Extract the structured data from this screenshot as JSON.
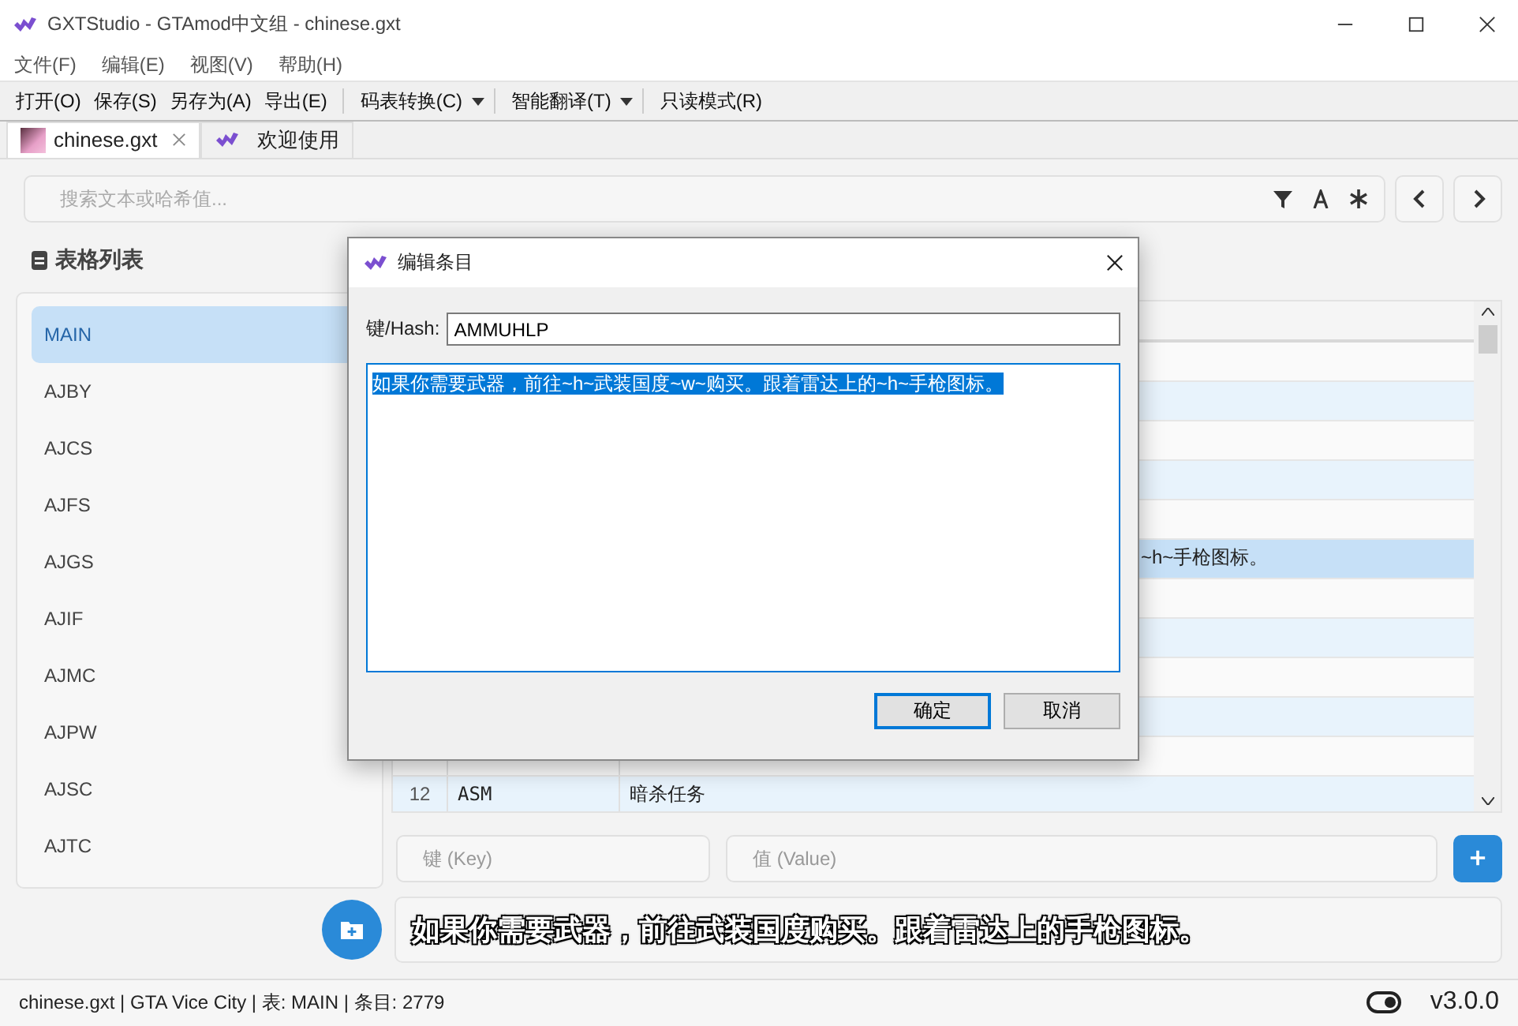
{
  "window": {
    "title": "GXTStudio - GTAmod中文组 - chinese.gxt"
  },
  "menu": [
    "文件(F)",
    "编辑(E)",
    "视图(V)",
    "帮助(H)"
  ],
  "toolbar": [
    {
      "label": "打开(O)",
      "kind": "button"
    },
    {
      "label": "保存(S)",
      "kind": "button"
    },
    {
      "label": "另存为(A)",
      "kind": "button"
    },
    {
      "label": "导出(E)",
      "kind": "button"
    },
    {
      "label": "码表转换(C)",
      "kind": "dropdown"
    },
    {
      "label": "智能翻译(T)",
      "kind": "dropdown"
    },
    {
      "label": "只读模式(R)",
      "kind": "button"
    }
  ],
  "tabs": [
    {
      "label": "chinese.gxt",
      "kind": "file",
      "selected": true
    },
    {
      "label": "欢迎使用",
      "kind": "welcome",
      "selected": false
    }
  ],
  "search": {
    "placeholder": "搜索文本或哈希值..."
  },
  "sidebar": {
    "title": "表格列表",
    "items": [
      {
        "label": "MAIN",
        "selected": true
      },
      {
        "label": "AJBY",
        "selected": false
      },
      {
        "label": "AJCS",
        "selected": false
      },
      {
        "label": "AJFS",
        "selected": false
      },
      {
        "label": "AJGS",
        "selected": false
      },
      {
        "label": "AJIF",
        "selected": false
      },
      {
        "label": "AJMC",
        "selected": false
      },
      {
        "label": "AJPW",
        "selected": false
      },
      {
        "label": "AJSC",
        "selected": false
      },
      {
        "label": "AJTC",
        "selected": false
      }
    ]
  },
  "table": {
    "rows": [
      {
        "selected": false
      },
      {
        "selected": false
      },
      {
        "selected": false
      },
      {
        "selected": false
      },
      {
        "selected": false
      },
      {
        "selected": true,
        "value_tail": "~h~手枪图标。"
      },
      {
        "selected": false
      },
      {
        "selected": false
      },
      {
        "selected": false
      },
      {
        "selected": false
      },
      {
        "selected": false
      },
      {
        "selected": false,
        "number": "12",
        "key": "ASM",
        "value": "暗杀任务"
      }
    ]
  },
  "add_form": {
    "key_placeholder": "键 (Key)",
    "value_placeholder": "值 (Value)"
  },
  "preview": {
    "text": "如果你需要武器，前往武装国度购买。跟着雷达上的手枪图标。"
  },
  "status_bar": {
    "text": "chinese.gxt | GTA Vice City | 表: MAIN | 条目: 2779",
    "version": "v3.0.0"
  },
  "dialog": {
    "title": "编辑条目",
    "key_label": "键/Hash:",
    "key_value": "AMMUHLP",
    "text": "如果你需要武器，前往~h~武装国度~w~购买。跟着雷达上的~h~手枪图标。",
    "buttons": [
      {
        "label": "确定",
        "kind": "default"
      },
      {
        "label": "取消",
        "kind": "normal"
      }
    ]
  }
}
